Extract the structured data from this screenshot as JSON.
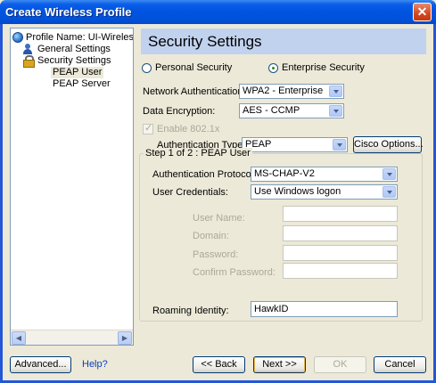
{
  "window": {
    "title": "Create Wireless Profile",
    "close_glyph": "✕"
  },
  "tree": {
    "profile_name": "Profile Name: UI-Wireless-WPA",
    "general_settings": "General Settings",
    "security_settings": "Security Settings",
    "peap_user": "PEAP User",
    "peap_server": "PEAP Server",
    "scroll_left": "◀",
    "scroll_right": "▶"
  },
  "panel": {
    "title": "Security Settings",
    "personal_security": "Personal Security",
    "enterprise_security": "Enterprise Security",
    "security_mode_selected": "Enterprise Security",
    "network_auth_label": "Network Authentication:",
    "network_auth_value": "WPA2 - Enterprise",
    "data_encryption_label": "Data Encryption:",
    "data_encryption_value": "AES - CCMP",
    "enable_8021x_label": "Enable 802.1x",
    "auth_type_label": "Authentication Type:",
    "auth_type_value": "PEAP",
    "cisco_options_button": "Cisco Options..."
  },
  "step_group": {
    "legend": "Step 1 of 2 : PEAP User",
    "auth_protocol_label": "Authentication Protocol:",
    "auth_protocol_value": "MS-CHAP-V2",
    "user_credentials_label": "User Credentials:",
    "user_credentials_value": "Use Windows logon",
    "user_name_label": "User Name:",
    "user_name_value": "",
    "domain_label": "Domain:",
    "domain_value": "",
    "password_label": "Password:",
    "password_value": "",
    "confirm_password_label": "Confirm Password:",
    "confirm_password_value": "",
    "roaming_identity_label": "Roaming Identity:",
    "roaming_identity_value": "HawkID"
  },
  "footer": {
    "advanced_button": "Advanced...",
    "help_link": "Help?",
    "back_button": "<< Back",
    "next_button": "Next >>",
    "ok_button": "OK",
    "cancel_button": "Cancel"
  },
  "colors": {
    "titlebar": "#0054e3",
    "header_band": "#c1d2ee",
    "window_bg": "#ece9d8",
    "link": "#0b3fbf"
  }
}
